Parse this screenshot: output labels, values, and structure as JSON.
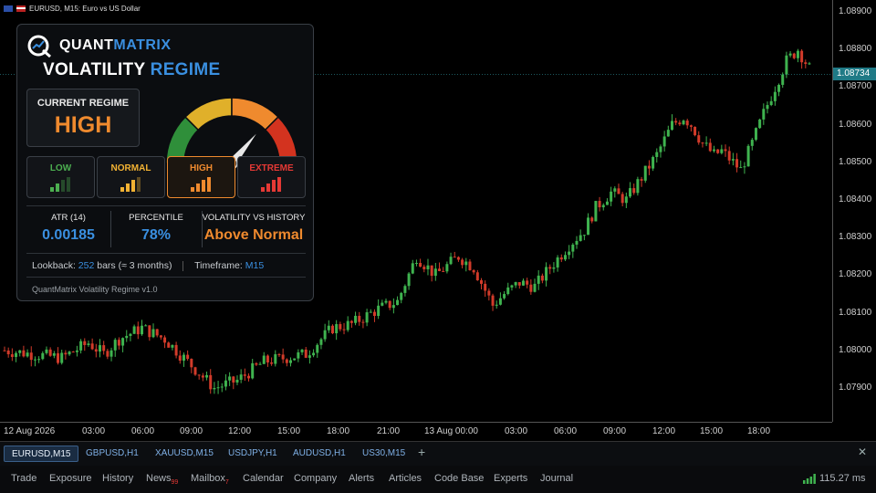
{
  "window_title": "EURUSD, M15: Euro vs US Dollar",
  "price_axis": {
    "ticks": [
      "1.08900",
      "1.08800",
      "1.08700",
      "1.08600",
      "1.08500",
      "1.08400",
      "1.08300",
      "1.08200",
      "1.08100",
      "1.08000",
      "1.07900"
    ],
    "tick_values": [
      1.089,
      1.088,
      1.087,
      1.086,
      1.085,
      1.084,
      1.083,
      1.082,
      1.081,
      1.08,
      1.079
    ],
    "current_price": "1.08734",
    "current_value": 1.08734
  },
  "time_axis": [
    "12 Aug 2026",
    "03:00",
    "06:00",
    "09:00",
    "12:00",
    "15:00",
    "18:00",
    "21:00",
    "13 Aug 00:00",
    "03:00",
    "06:00",
    "09:00",
    "12:00",
    "15:00",
    "18:00"
  ],
  "colors": {
    "bull": "#3fb34f",
    "bear": "#d23b2a",
    "accent": "#3a8fe0",
    "high": "#ef8a2e",
    "price_line": "#2c8c96"
  },
  "panel": {
    "brand_a": "QUANT",
    "brand_b": "MATRIX",
    "title_a": "VOLATILITY",
    "title_b": "REGIME",
    "current_label": "CURRENT REGIME",
    "current_value": "HIGH",
    "gauge_needle_fraction": 0.72,
    "regimes": [
      {
        "label": "LOW",
        "color": "#4caf50"
      },
      {
        "label": "NORMAL",
        "color": "#f2b233"
      },
      {
        "label": "HIGH",
        "color": "#ef8a2e"
      },
      {
        "label": "EXTREME",
        "color": "#e53935"
      }
    ],
    "stats": [
      {
        "label": "ATR (14)",
        "value": "0.00185",
        "color": "#3a8fe0"
      },
      {
        "label": "PERCENTILE",
        "value": "78%",
        "color": "#3a8fe0"
      },
      {
        "label": "VOLATILITY VS HISTORY",
        "value": "Above Normal",
        "color": "#ef8a2e"
      }
    ],
    "lookback_prefix": "Lookback: ",
    "lookback_bars": "252",
    "lookback_suffix": " bars (≈ 3 months)",
    "timeframe_prefix": "Timeframe: ",
    "timeframe_value": "M15",
    "version": "QuantMatrix Volatility Regime v1.0"
  },
  "tabs": [
    {
      "label": "EURUSD,M15",
      "active": true
    },
    {
      "label": "GBPUSD,H1"
    },
    {
      "label": "XAUUSD,M15"
    },
    {
      "label": "USDJPY,H1"
    },
    {
      "label": "AUDUSD,H1"
    },
    {
      "label": "US30,M15"
    }
  ],
  "tab_add": "+",
  "tab_close": "✕",
  "menu": [
    {
      "label": "Trade"
    },
    {
      "label": "Exposure"
    },
    {
      "label": "History"
    },
    {
      "label": "News",
      "badge": "99"
    },
    {
      "label": "Mailbox",
      "badge": "7"
    },
    {
      "label": "Calendar"
    },
    {
      "label": "Company"
    },
    {
      "label": "Alerts"
    },
    {
      "label": "Articles"
    },
    {
      "label": "Code Base"
    },
    {
      "label": "Experts"
    },
    {
      "label": "Journal"
    }
  ],
  "ping": "115.27 ms"
}
